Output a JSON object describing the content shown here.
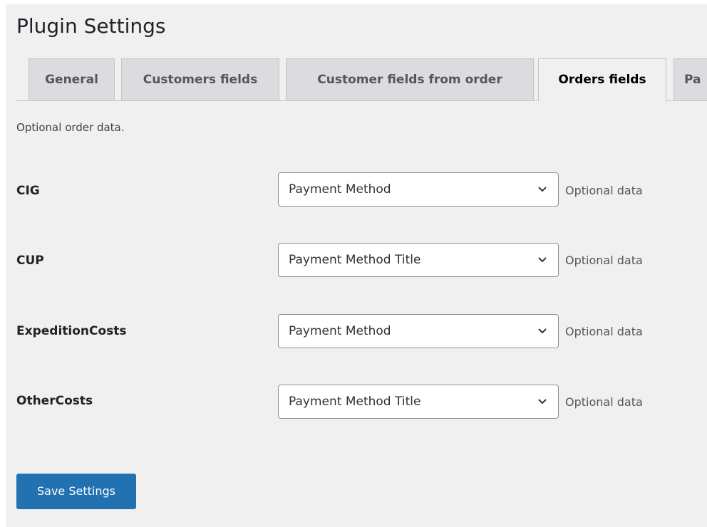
{
  "page": {
    "title": "Plugin Settings"
  },
  "tabs": [
    {
      "label": "General",
      "active": false
    },
    {
      "label": "Customers fields",
      "active": false
    },
    {
      "label": "Customer fields from order",
      "active": false
    },
    {
      "label": "Orders fields",
      "active": true
    },
    {
      "label": "Pa",
      "active": false
    }
  ],
  "section": {
    "intro": "Optional order data."
  },
  "fields": [
    {
      "label": "CIG",
      "selected": "Payment Method",
      "description": "Optional data"
    },
    {
      "label": "CUP",
      "selected": "Payment Method Title",
      "description": "Optional data"
    },
    {
      "label": "ExpeditionCosts",
      "selected": "Payment Method",
      "description": "Optional data"
    },
    {
      "label": "OtherCosts",
      "selected": "Payment Method Title",
      "description": "Optional data"
    }
  ],
  "actions": {
    "save_label": "Save Settings"
  },
  "colors": {
    "page_background": "#f0f0f1",
    "primary_button": "#2271b1",
    "tab_inactive": "#dcdcde"
  }
}
